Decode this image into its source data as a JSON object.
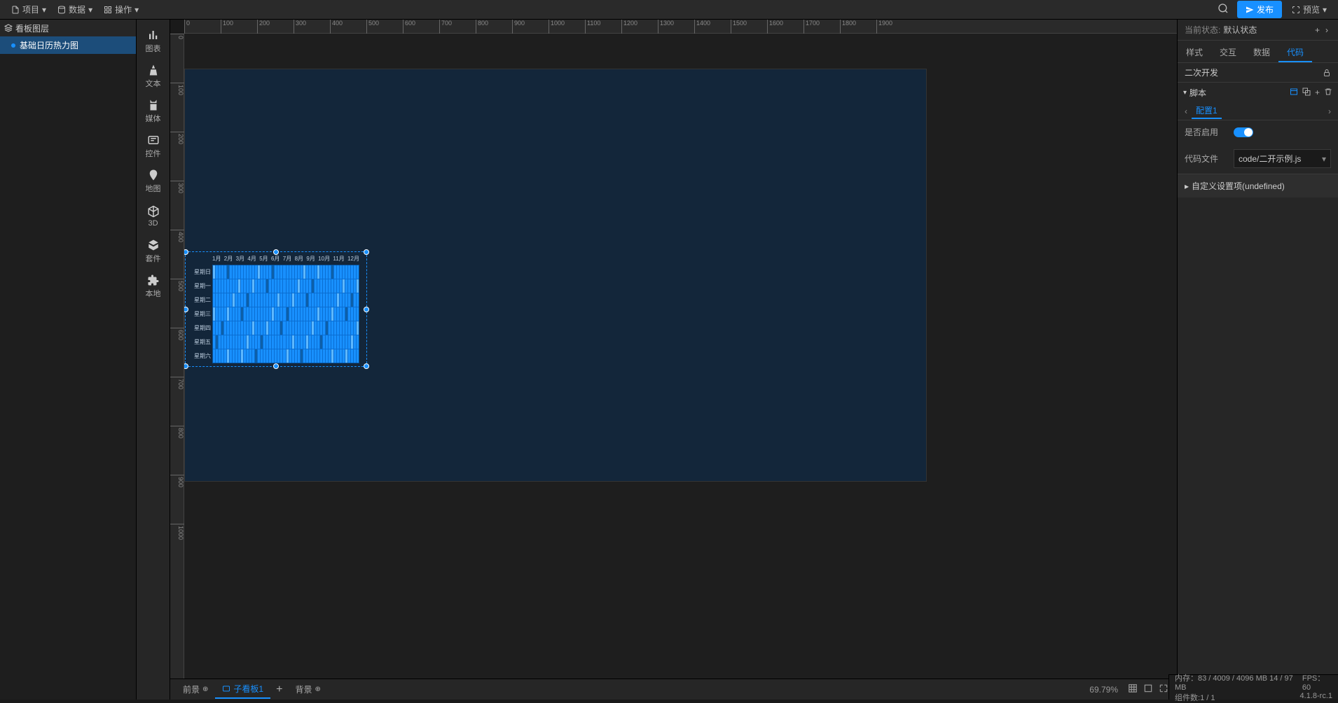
{
  "topbar": {
    "project": "项目",
    "data": "数据",
    "operate": "操作",
    "publish": "发布",
    "preview": "预览"
  },
  "layers": {
    "title": "看板图层",
    "items": [
      {
        "name": "基础日历热力图"
      }
    ]
  },
  "toolbox": [
    {
      "id": "chart",
      "label": "图表"
    },
    {
      "id": "text",
      "label": "文本"
    },
    {
      "id": "media",
      "label": "媒体"
    },
    {
      "id": "control",
      "label": "控件"
    },
    {
      "id": "map",
      "label": "地图"
    },
    {
      "id": "3d",
      "label": "3D"
    },
    {
      "id": "suite",
      "label": "套件"
    },
    {
      "id": "local",
      "label": "本地"
    }
  ],
  "ruler_ticks": [
    "0",
    "100",
    "200",
    "300",
    "400",
    "500",
    "600",
    "700",
    "800",
    "900",
    "1000",
    "1100",
    "1200",
    "1300",
    "1400",
    "1500",
    "1600",
    "1700",
    "1800",
    "1900"
  ],
  "ruler_vticks": [
    "0",
    "100",
    "200",
    "300",
    "400",
    "500",
    "600",
    "700",
    "800",
    "900",
    "1000"
  ],
  "bottom": {
    "fore": "前景",
    "sub": "子看板1",
    "back": "背景",
    "zoom": "69.79%"
  },
  "inspector": {
    "state_label": "当前状态:",
    "state_value": "默认状态",
    "tabs": [
      "样式",
      "交互",
      "数据",
      "代码"
    ],
    "sub_title": "二次开发",
    "section_script": "脚本",
    "config_tab": "配置1",
    "enable_label": "是否启用",
    "codefile_label": "代码文件",
    "codefile_value": "code/二开示例.js",
    "custom_setting": "自定义设置项(undefined)"
  },
  "status": {
    "mem_label": "内存：",
    "mem_value": "83 / 4009 / 4096 MB  14 / 97 MB",
    "fps_label": "FPS：",
    "fps_value": "60",
    "comp_label": "组件数:",
    "comp_value": "1 / 1",
    "ver": "4.1.8-rc.1"
  },
  "chart_data": {
    "type": "heatmap",
    "title": "",
    "x_categories": [
      "1月",
      "2月",
      "3月",
      "4月",
      "5月",
      "6月",
      "7月",
      "8月",
      "9月",
      "10月",
      "11月",
      "12月"
    ],
    "y_categories": [
      "星期日",
      "星期一",
      "星期二",
      "星期三",
      "星期四",
      "星期五",
      "星期六"
    ],
    "note": "Calendar heatmap — days of week vs weeks of year; most cells medium-blue, sparse lighter/darker outliers. Exact per-cell values not readable at rendered zoom.",
    "value_range": [
      0,
      10
    ]
  }
}
